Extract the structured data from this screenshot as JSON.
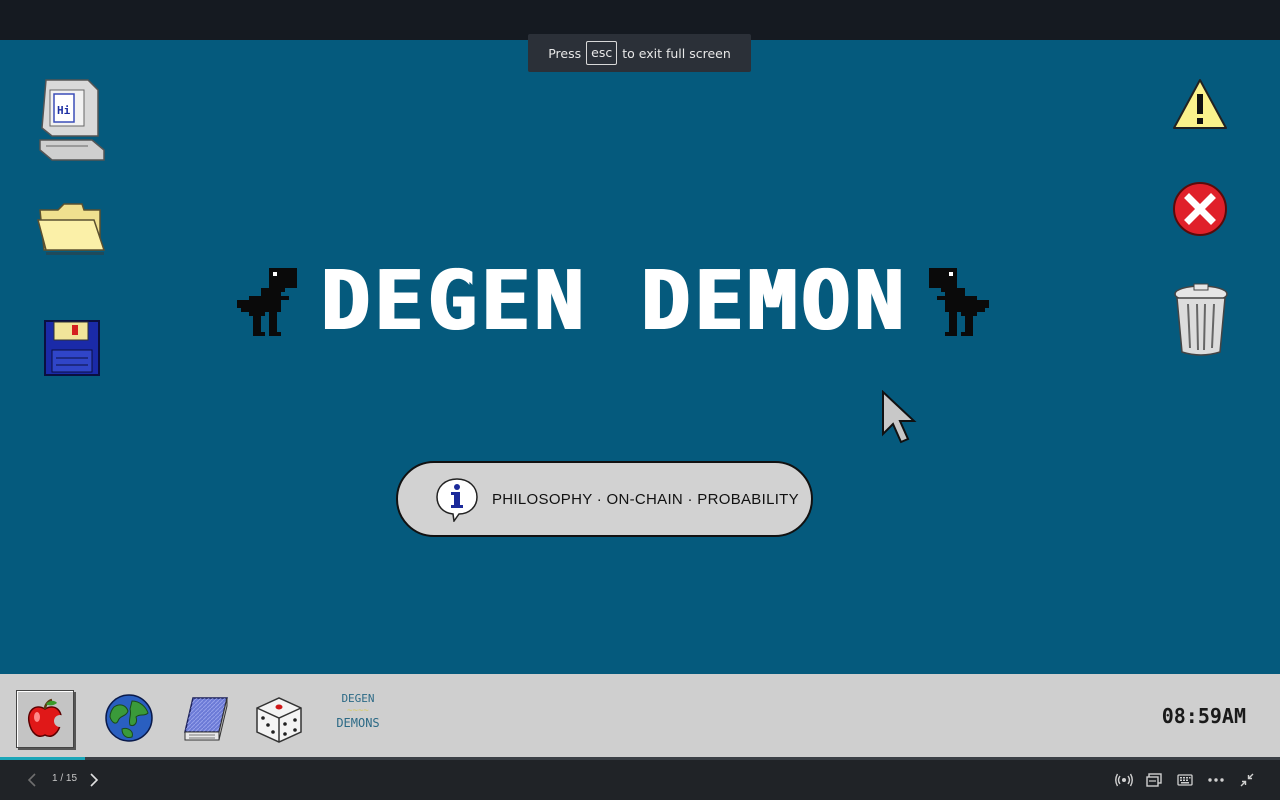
{
  "fullscreen_toast": {
    "prefix": "Press",
    "key": "esc",
    "suffix": "to exit full screen"
  },
  "slide": {
    "title": "DEGEN DEMON",
    "tagline": "PHILOSOPHY · ON-CHAIN · PROBABILITY",
    "background_color": "#055a7d"
  },
  "desktop_icons_left": [
    "computer-icon",
    "folder-icon",
    "floppy-disk-icon"
  ],
  "desktop_icons_right": [
    "warning-icon",
    "error-icon",
    "trash-icon"
  ],
  "taskbar": {
    "items": [
      "apple-icon",
      "globe-icon",
      "notepad-icon",
      "dice-icon"
    ],
    "logo_top": "DEGEN",
    "logo_bottom": "DEMONS",
    "clock": "08:59AM"
  },
  "presentation": {
    "page_indicator": "1 / 15",
    "progress": 0.0667,
    "accent": "#1ba6b8"
  }
}
